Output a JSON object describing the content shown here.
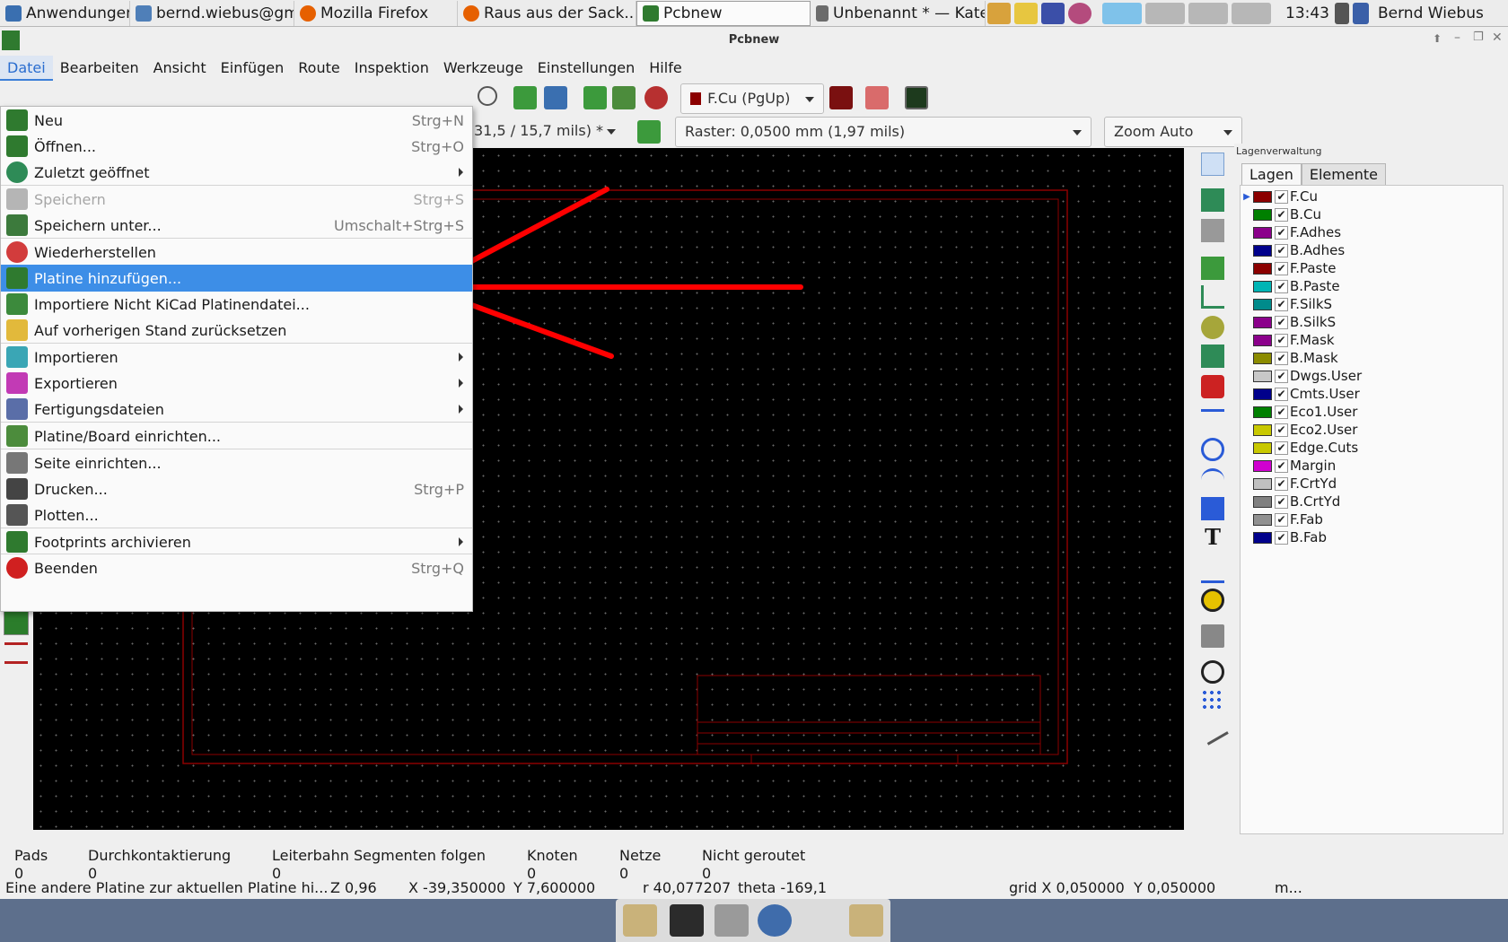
{
  "taskbar": {
    "apps_label": "Anwendungen",
    "tasks": [
      {
        "label": "bernd.wiebus@gm..."
      },
      {
        "label": "Mozilla Firefox"
      },
      {
        "label": "Raus aus der Sack..."
      },
      {
        "label": "Pcbnew"
      },
      {
        "label": "Unbenannt * — Kate"
      }
    ],
    "clock": "13:43",
    "user": "Bernd Wiebus"
  },
  "window": {
    "title": "Pcbnew"
  },
  "menubar": [
    "Datei",
    "Bearbeiten",
    "Ansicht",
    "Einfügen",
    "Route",
    "Inspektion",
    "Werkzeuge",
    "Einstellungen",
    "Hilfe"
  ],
  "toolbar": {
    "layer_combo": "F.Cu (PgUp)",
    "track_combo": "31,5 / 15,7 mils) *",
    "grid_combo": "Raster: 0,0500 mm (1,97 mils)",
    "zoom_combo": "Zoom Auto"
  },
  "file_menu": {
    "items": [
      {
        "label": "Neu",
        "shortcut": "Strg+N"
      },
      {
        "label": "Öffnen...",
        "shortcut": "Strg+O"
      },
      {
        "label": "Zuletzt geöffnet",
        "shortcut": ""
      },
      {
        "label": "Speichern",
        "shortcut": "Strg+S"
      },
      {
        "label": "Speichern unter...",
        "shortcut": "Umschalt+Strg+S"
      },
      {
        "label": "Wiederherstellen",
        "shortcut": ""
      },
      {
        "label": "Platine hinzufügen...",
        "shortcut": ""
      },
      {
        "label": "Importiere Nicht KiCad Platinendatei...",
        "shortcut": ""
      },
      {
        "label": "Auf vorherigen Stand zurücksetzen",
        "shortcut": ""
      },
      {
        "label": "Importieren",
        "shortcut": ""
      },
      {
        "label": "Exportieren",
        "shortcut": ""
      },
      {
        "label": "Fertigungsdateien",
        "shortcut": ""
      },
      {
        "label": "Platine/Board einrichten...",
        "shortcut": ""
      },
      {
        "label": "Seite einrichten...",
        "shortcut": ""
      },
      {
        "label": "Drucken...",
        "shortcut": "Strg+P"
      },
      {
        "label": "Plotten...",
        "shortcut": ""
      },
      {
        "label": "Footprints archivieren",
        "shortcut": ""
      },
      {
        "label": "Beenden",
        "shortcut": "Strg+Q"
      }
    ]
  },
  "layer_panel": {
    "title": "Lagenverwaltung",
    "tabs": [
      "Lagen",
      "Elemente"
    ],
    "layers": [
      {
        "name": "F.Cu",
        "color": "#8b0000"
      },
      {
        "name": "B.Cu",
        "color": "#008000"
      },
      {
        "name": "F.Adhes",
        "color": "#8b008b"
      },
      {
        "name": "B.Adhes",
        "color": "#00008b"
      },
      {
        "name": "F.Paste",
        "color": "#8b0000"
      },
      {
        "name": "B.Paste",
        "color": "#00b5b5"
      },
      {
        "name": "F.SilkS",
        "color": "#008b8b"
      },
      {
        "name": "B.SilkS",
        "color": "#8b008b"
      },
      {
        "name": "F.Mask",
        "color": "#8b008b"
      },
      {
        "name": "B.Mask",
        "color": "#8b8b00"
      },
      {
        "name": "Dwgs.User",
        "color": "#c8c8c8"
      },
      {
        "name": "Cmts.User",
        "color": "#00008b"
      },
      {
        "name": "Eco1.User",
        "color": "#008000"
      },
      {
        "name": "Eco2.User",
        "color": "#c8c800"
      },
      {
        "name": "Edge.Cuts",
        "color": "#c8c800"
      },
      {
        "name": "Margin",
        "color": "#d000d0"
      },
      {
        "name": "F.CrtYd",
        "color": "#c0c0c0"
      },
      {
        "name": "B.CrtYd",
        "color": "#808080"
      },
      {
        "name": "F.Fab",
        "color": "#909090"
      },
      {
        "name": "B.Fab",
        "color": "#00008b"
      }
    ]
  },
  "status": {
    "columns": [
      {
        "label": "Pads",
        "value": "0"
      },
      {
        "label": "Durchkontaktierung",
        "value": "0"
      },
      {
        "label": "Leiterbahn Segmenten folgen",
        "value": "0"
      },
      {
        "label": "Knoten",
        "value": "0"
      },
      {
        "label": "Netze",
        "value": "0"
      },
      {
        "label": "Nicht geroutet",
        "value": "0"
      }
    ],
    "message": "Eine andere Platine zur aktuellen Platine hi...",
    "zoom": "Z 0,96",
    "x": "X -39,350000",
    "y": "Y 7,600000",
    "r": "r 40,077207",
    "theta": "theta -169,1",
    "grid": "grid X 0,050000  Y 0,050000",
    "units": "m..."
  },
  "colors": {
    "accent": "#3d8ee7",
    "annotation_arrow": "#ff0000",
    "board_frame": "#8b0000"
  }
}
